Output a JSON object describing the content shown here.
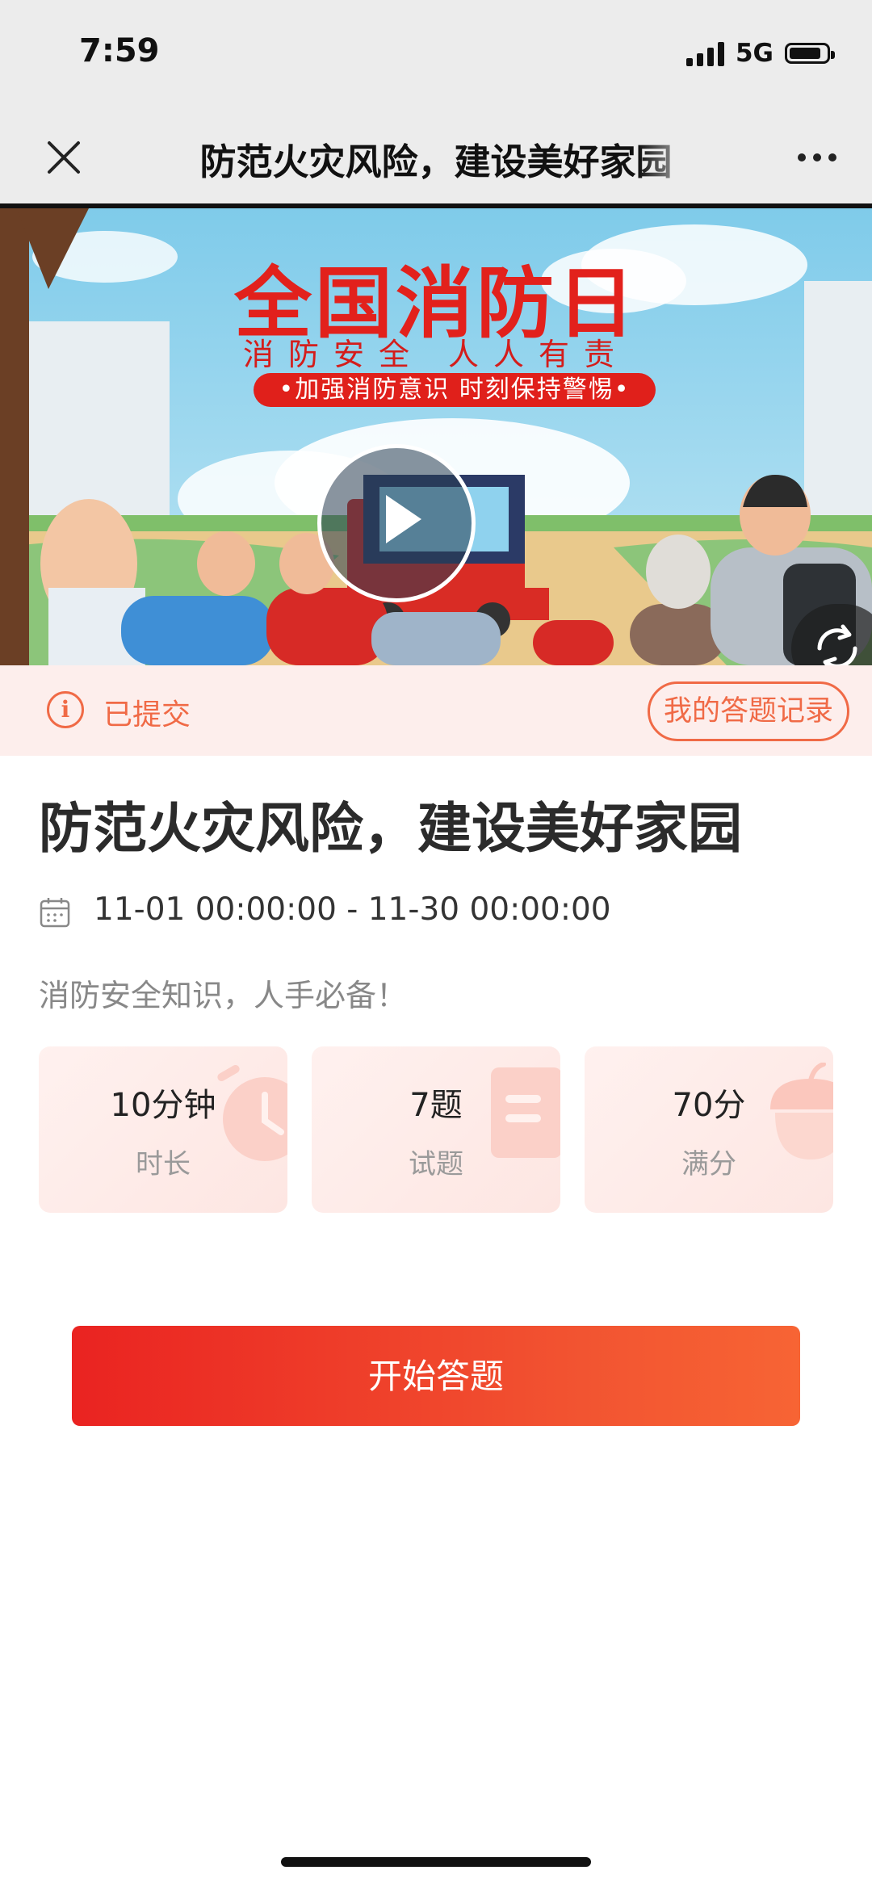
{
  "status": {
    "time": "7:59",
    "network": "5G",
    "battery_level": 0.85
  },
  "nav": {
    "title": "防范火灾风险，建设美好家园"
  },
  "banner": {
    "headline": "全国消防日",
    "slogan": "消防安全 人人有责",
    "pill_text": "•加强消防意识 时刻保持警惕•"
  },
  "notice": {
    "status_text": "已提交",
    "record_button": "我的答题记录"
  },
  "content": {
    "title": "防范火灾风险，建设美好家园",
    "date_range": "11-01 00:00:00 - 11-30 00:00:00",
    "subtitle": "消防安全知识，人手必备！"
  },
  "stats": [
    {
      "value": "10分钟",
      "label": "时长",
      "icon": "clock-icon"
    },
    {
      "value": "7题",
      "label": "试题",
      "icon": "document-icon"
    },
    {
      "value": "70分",
      "label": "满分",
      "icon": "acorn-icon"
    }
  ],
  "actions": {
    "start_label": "开始答题"
  },
  "colors": {
    "accent": "#f06a46",
    "primary_start": "#ea2321",
    "primary_end": "#f76434"
  }
}
